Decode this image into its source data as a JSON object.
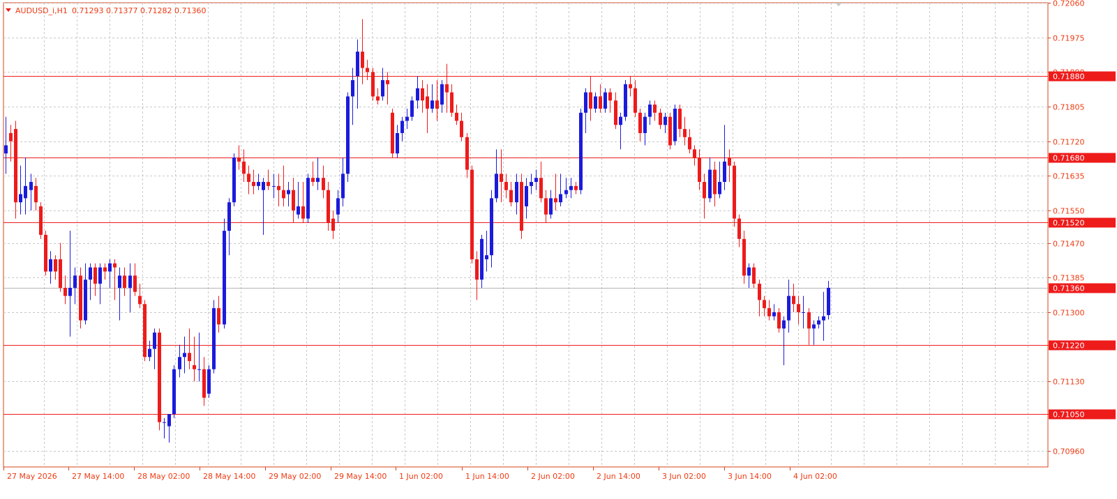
{
  "header": {
    "symbol": "AUDUSD_i,H1",
    "ohlc": "0.71293 0.71377 0.71282 0.71360"
  },
  "colors": {
    "frame": "#d84315",
    "grid": "#c8c8c8",
    "bull": "#1b1bdc",
    "bear": "#ee1b1b",
    "level": "#ee1b1b",
    "price_line": "#b4b4b4",
    "label_bg": "#ee1b1b",
    "label_text": "#ffffff",
    "axis_text": "#ee3a12"
  },
  "chart_data": {
    "type": "candlestick",
    "timeframe": "H1",
    "ylim": [
      0.7092,
      0.7206
    ],
    "y_ticks": [
      "0.72060",
      "0.71975",
      "0.71890",
      "0.71805",
      "0.71720",
      "0.71635",
      "0.71550",
      "0.71470",
      "0.71385",
      "0.71300",
      "0.71220",
      "0.71130",
      "0.71050",
      "0.70960"
    ],
    "x_ticks": [
      "27 May 2026",
      "27 May 14:00",
      "28 May 02:00",
      "28 May 14:00",
      "29 May 02:00",
      "29 May 14:00",
      "1 Jun 02:00",
      "1 Jun 14:00",
      "2 Jun 02:00",
      "2 Jun 14:00",
      "3 Jun 02:00",
      "3 Jun 14:00",
      "4 Jun 02:00"
    ],
    "levels": [
      "0.71880",
      "0.71680",
      "0.71520",
      "0.71220",
      "0.71050"
    ],
    "current_price": "0.71360",
    "candles": [
      {
        "o": 0.7169,
        "h": 0.7178,
        "l": 0.7164,
        "c": 0.7171
      },
      {
        "o": 0.7174,
        "h": 0.7176,
        "l": 0.7167,
        "c": 0.7172
      },
      {
        "o": 0.7175,
        "h": 0.7177,
        "l": 0.7153,
        "c": 0.7157
      },
      {
        "o": 0.7157,
        "h": 0.7166,
        "l": 0.7154,
        "c": 0.7159
      },
      {
        "o": 0.7158,
        "h": 0.7168,
        "l": 0.7154,
        "c": 0.7161
      },
      {
        "o": 0.716,
        "h": 0.7164,
        "l": 0.7155,
        "c": 0.7162
      },
      {
        "o": 0.7161,
        "h": 0.7163,
        "l": 0.7155,
        "c": 0.7157
      },
      {
        "o": 0.7156,
        "h": 0.7157,
        "l": 0.7148,
        "c": 0.7149
      },
      {
        "o": 0.7149,
        "h": 0.715,
        "l": 0.7139,
        "c": 0.714
      },
      {
        "o": 0.714,
        "h": 0.7145,
        "l": 0.7137,
        "c": 0.7143
      },
      {
        "o": 0.7143,
        "h": 0.7144,
        "l": 0.7138,
        "c": 0.714
      },
      {
        "o": 0.7143,
        "h": 0.7147,
        "l": 0.7135,
        "c": 0.7136
      },
      {
        "o": 0.7136,
        "h": 0.7139,
        "l": 0.7132,
        "c": 0.7134
      },
      {
        "o": 0.7134,
        "h": 0.715,
        "l": 0.7124,
        "c": 0.7136
      },
      {
        "o": 0.7136,
        "h": 0.7141,
        "l": 0.7132,
        "c": 0.7139
      },
      {
        "o": 0.7139,
        "h": 0.7141,
        "l": 0.7126,
        "c": 0.7128
      },
      {
        "o": 0.7128,
        "h": 0.7142,
        "l": 0.7127,
        "c": 0.7138
      },
      {
        "o": 0.7138,
        "h": 0.7142,
        "l": 0.7133,
        "c": 0.7141
      },
      {
        "o": 0.7141,
        "h": 0.7142,
        "l": 0.7134,
        "c": 0.7137
      },
      {
        "o": 0.7137,
        "h": 0.7142,
        "l": 0.7132,
        "c": 0.7141
      },
      {
        "o": 0.7141,
        "h": 0.7142,
        "l": 0.7138,
        "c": 0.714
      },
      {
        "o": 0.714,
        "h": 0.7143,
        "l": 0.7136,
        "c": 0.7142
      },
      {
        "o": 0.7142,
        "h": 0.7143,
        "l": 0.7133,
        "c": 0.7141
      },
      {
        "o": 0.7136,
        "h": 0.7141,
        "l": 0.7128,
        "c": 0.7139
      },
      {
        "o": 0.7139,
        "h": 0.7141,
        "l": 0.7134,
        "c": 0.7136
      },
      {
        "o": 0.7136,
        "h": 0.7142,
        "l": 0.713,
        "c": 0.7139
      },
      {
        "o": 0.7139,
        "h": 0.7142,
        "l": 0.7134,
        "c": 0.7135
      },
      {
        "o": 0.7134,
        "h": 0.7137,
        "l": 0.7131,
        "c": 0.7132
      },
      {
        "o": 0.7132,
        "h": 0.7133,
        "l": 0.7118,
        "c": 0.7119
      },
      {
        "o": 0.7119,
        "h": 0.7123,
        "l": 0.7118,
        "c": 0.7121
      },
      {
        "o": 0.7121,
        "h": 0.7126,
        "l": 0.7116,
        "c": 0.7125
      },
      {
        "o": 0.7125,
        "h": 0.7126,
        "l": 0.7101,
        "c": 0.7103
      },
      {
        "o": 0.7103,
        "h": 0.7104,
        "l": 0.7099,
        "c": 0.7103
      },
      {
        "o": 0.7102,
        "h": 0.7105,
        "l": 0.7098,
        "c": 0.7105
      },
      {
        "o": 0.7105,
        "h": 0.7117,
        "l": 0.7104,
        "c": 0.7116
      },
      {
        "o": 0.7116,
        "h": 0.7122,
        "l": 0.7114,
        "c": 0.7119
      },
      {
        "o": 0.7119,
        "h": 0.7124,
        "l": 0.7115,
        "c": 0.712
      },
      {
        "o": 0.712,
        "h": 0.7126,
        "l": 0.7116,
        "c": 0.7118
      },
      {
        "o": 0.7117,
        "h": 0.7124,
        "l": 0.7113,
        "c": 0.7116
      },
      {
        "o": 0.7116,
        "h": 0.7125,
        "l": 0.7113,
        "c": 0.7116
      },
      {
        "o": 0.7116,
        "h": 0.7119,
        "l": 0.7107,
        "c": 0.7109
      },
      {
        "o": 0.711,
        "h": 0.7117,
        "l": 0.7109,
        "c": 0.7116
      },
      {
        "o": 0.7116,
        "h": 0.7133,
        "l": 0.7115,
        "c": 0.7131
      },
      {
        "o": 0.7131,
        "h": 0.7134,
        "l": 0.7125,
        "c": 0.7127
      },
      {
        "o": 0.7127,
        "h": 0.7153,
        "l": 0.7126,
        "c": 0.715
      },
      {
        "o": 0.715,
        "h": 0.7158,
        "l": 0.7144,
        "c": 0.7157
      },
      {
        "o": 0.7157,
        "h": 0.7169,
        "l": 0.7156,
        "c": 0.7168
      },
      {
        "o": 0.7168,
        "h": 0.7171,
        "l": 0.7165,
        "c": 0.7167
      },
      {
        "o": 0.7167,
        "h": 0.717,
        "l": 0.7162,
        "c": 0.7164
      },
      {
        "o": 0.7164,
        "h": 0.7166,
        "l": 0.7159,
        "c": 0.7162
      },
      {
        "o": 0.7162,
        "h": 0.7165,
        "l": 0.7159,
        "c": 0.7161
      },
      {
        "o": 0.7161,
        "h": 0.7164,
        "l": 0.716,
        "c": 0.7162
      },
      {
        "o": 0.716,
        "h": 0.7163,
        "l": 0.7149,
        "c": 0.7162
      },
      {
        "o": 0.7162,
        "h": 0.7165,
        "l": 0.716,
        "c": 0.7161
      },
      {
        "o": 0.7161,
        "h": 0.7164,
        "l": 0.7158,
        "c": 0.7161
      },
      {
        "o": 0.7161,
        "h": 0.7164,
        "l": 0.7156,
        "c": 0.716
      },
      {
        "o": 0.716,
        "h": 0.7166,
        "l": 0.7156,
        "c": 0.7158
      },
      {
        "o": 0.7159,
        "h": 0.7162,
        "l": 0.7156,
        "c": 0.716
      },
      {
        "o": 0.716,
        "h": 0.7163,
        "l": 0.7152,
        "c": 0.7155
      },
      {
        "o": 0.7154,
        "h": 0.7162,
        "l": 0.7153,
        "c": 0.7156
      },
      {
        "o": 0.7156,
        "h": 0.7162,
        "l": 0.7152,
        "c": 0.7153
      },
      {
        "o": 0.7153,
        "h": 0.7164,
        "l": 0.7152,
        "c": 0.7163
      },
      {
        "o": 0.7163,
        "h": 0.7167,
        "l": 0.7161,
        "c": 0.7162
      },
      {
        "o": 0.7162,
        "h": 0.7168,
        "l": 0.716,
        "c": 0.7163
      },
      {
        "o": 0.7163,
        "h": 0.7166,
        "l": 0.7158,
        "c": 0.716
      },
      {
        "o": 0.716,
        "h": 0.7162,
        "l": 0.715,
        "c": 0.7152
      },
      {
        "o": 0.7153,
        "h": 0.7155,
        "l": 0.7148,
        "c": 0.715
      },
      {
        "o": 0.7154,
        "h": 0.716,
        "l": 0.7152,
        "c": 0.7158
      },
      {
        "o": 0.7158,
        "h": 0.7168,
        "l": 0.7156,
        "c": 0.7164
      },
      {
        "o": 0.7164,
        "h": 0.7184,
        "l": 0.7162,
        "c": 0.7183
      },
      {
        "o": 0.7183,
        "h": 0.719,
        "l": 0.7176,
        "c": 0.7187
      },
      {
        "o": 0.7188,
        "h": 0.7197,
        "l": 0.718,
        "c": 0.7194
      },
      {
        "o": 0.7194,
        "h": 0.7202,
        "l": 0.7186,
        "c": 0.719
      },
      {
        "o": 0.719,
        "h": 0.7192,
        "l": 0.7187,
        "c": 0.7189
      },
      {
        "o": 0.7189,
        "h": 0.719,
        "l": 0.7182,
        "c": 0.7183
      },
      {
        "o": 0.7183,
        "h": 0.7185,
        "l": 0.7181,
        "c": 0.7182
      },
      {
        "o": 0.7183,
        "h": 0.719,
        "l": 0.7182,
        "c": 0.7187
      },
      {
        "o": 0.7187,
        "h": 0.7189,
        "l": 0.7181,
        "c": 0.7186
      },
      {
        "o": 0.7179,
        "h": 0.718,
        "l": 0.7168,
        "c": 0.7169
      },
      {
        "o": 0.7169,
        "h": 0.7176,
        "l": 0.7168,
        "c": 0.7174
      },
      {
        "o": 0.7174,
        "h": 0.7178,
        "l": 0.7172,
        "c": 0.7177
      },
      {
        "o": 0.7177,
        "h": 0.718,
        "l": 0.7175,
        "c": 0.7178
      },
      {
        "o": 0.7178,
        "h": 0.7183,
        "l": 0.7177,
        "c": 0.7182
      },
      {
        "o": 0.7182,
        "h": 0.7188,
        "l": 0.718,
        "c": 0.7185
      },
      {
        "o": 0.7185,
        "h": 0.7187,
        "l": 0.7179,
        "c": 0.7182
      },
      {
        "o": 0.7183,
        "h": 0.7186,
        "l": 0.7174,
        "c": 0.718
      },
      {
        "o": 0.718,
        "h": 0.7186,
        "l": 0.7179,
        "c": 0.7182
      },
      {
        "o": 0.7182,
        "h": 0.7187,
        "l": 0.7177,
        "c": 0.718
      },
      {
        "o": 0.7181,
        "h": 0.7187,
        "l": 0.7179,
        "c": 0.7186
      },
      {
        "o": 0.7186,
        "h": 0.7191,
        "l": 0.7179,
        "c": 0.7184
      },
      {
        "o": 0.7184,
        "h": 0.7186,
        "l": 0.7178,
        "c": 0.7179
      },
      {
        "o": 0.7179,
        "h": 0.7181,
        "l": 0.7176,
        "c": 0.7177
      },
      {
        "o": 0.7177,
        "h": 0.7179,
        "l": 0.7172,
        "c": 0.7173
      },
      {
        "o": 0.7173,
        "h": 0.7174,
        "l": 0.7163,
        "c": 0.7165
      },
      {
        "o": 0.7165,
        "h": 0.7166,
        "l": 0.7142,
        "c": 0.7143
      },
      {
        "o": 0.7143,
        "h": 0.7145,
        "l": 0.7133,
        "c": 0.7138
      },
      {
        "o": 0.7138,
        "h": 0.7149,
        "l": 0.7136,
        "c": 0.7148
      },
      {
        "o": 0.7143,
        "h": 0.715,
        "l": 0.714,
        "c": 0.7144
      },
      {
        "o": 0.7144,
        "h": 0.716,
        "l": 0.7141,
        "c": 0.7158
      },
      {
        "o": 0.7158,
        "h": 0.717,
        "l": 0.7157,
        "c": 0.7164
      },
      {
        "o": 0.7164,
        "h": 0.717,
        "l": 0.7157,
        "c": 0.7162
      },
      {
        "o": 0.7162,
        "h": 0.7164,
        "l": 0.7158,
        "c": 0.716
      },
      {
        "o": 0.716,
        "h": 0.7162,
        "l": 0.7156,
        "c": 0.7157
      },
      {
        "o": 0.7157,
        "h": 0.7164,
        "l": 0.7154,
        "c": 0.7162
      },
      {
        "o": 0.7162,
        "h": 0.7164,
        "l": 0.7148,
        "c": 0.715
      },
      {
        "o": 0.7156,
        "h": 0.7163,
        "l": 0.7153,
        "c": 0.7161
      },
      {
        "o": 0.7161,
        "h": 0.7164,
        "l": 0.7159,
        "c": 0.7162
      },
      {
        "o": 0.7162,
        "h": 0.7165,
        "l": 0.716,
        "c": 0.7163
      },
      {
        "o": 0.7163,
        "h": 0.7167,
        "l": 0.7157,
        "c": 0.7158
      },
      {
        "o": 0.7158,
        "h": 0.716,
        "l": 0.7152,
        "c": 0.7154
      },
      {
        "o": 0.7154,
        "h": 0.716,
        "l": 0.7153,
        "c": 0.7158
      },
      {
        "o": 0.7158,
        "h": 0.7164,
        "l": 0.7155,
        "c": 0.7157
      },
      {
        "o": 0.7157,
        "h": 0.7164,
        "l": 0.7156,
        "c": 0.7159
      },
      {
        "o": 0.7159,
        "h": 0.7163,
        "l": 0.7158,
        "c": 0.716
      },
      {
        "o": 0.716,
        "h": 0.7163,
        "l": 0.7158,
        "c": 0.7161
      },
      {
        "o": 0.7161,
        "h": 0.7162,
        "l": 0.7159,
        "c": 0.716
      },
      {
        "o": 0.716,
        "h": 0.718,
        "l": 0.7159,
        "c": 0.7179
      },
      {
        "o": 0.7179,
        "h": 0.7185,
        "l": 0.7174,
        "c": 0.7184
      },
      {
        "o": 0.7184,
        "h": 0.7188,
        "l": 0.7177,
        "c": 0.718
      },
      {
        "o": 0.718,
        "h": 0.7184,
        "l": 0.7179,
        "c": 0.7183
      },
      {
        "o": 0.7183,
        "h": 0.7186,
        "l": 0.7179,
        "c": 0.718
      },
      {
        "o": 0.718,
        "h": 0.7185,
        "l": 0.7179,
        "c": 0.7184
      },
      {
        "o": 0.7184,
        "h": 0.7185,
        "l": 0.7179,
        "c": 0.7182
      },
      {
        "o": 0.7182,
        "h": 0.7184,
        "l": 0.7175,
        "c": 0.7176
      },
      {
        "o": 0.7176,
        "h": 0.7179,
        "l": 0.717,
        "c": 0.7178
      },
      {
        "o": 0.7178,
        "h": 0.7187,
        "l": 0.7177,
        "c": 0.7186
      },
      {
        "o": 0.7186,
        "h": 0.7188,
        "l": 0.7183,
        "c": 0.7185
      },
      {
        "o": 0.7185,
        "h": 0.7187,
        "l": 0.7178,
        "c": 0.7179
      },
      {
        "o": 0.7179,
        "h": 0.718,
        "l": 0.7172,
        "c": 0.7174
      },
      {
        "o": 0.7174,
        "h": 0.7179,
        "l": 0.7171,
        "c": 0.7178
      },
      {
        "o": 0.7178,
        "h": 0.7182,
        "l": 0.7176,
        "c": 0.7181
      },
      {
        "o": 0.7181,
        "h": 0.7182,
        "l": 0.7177,
        "c": 0.7179
      },
      {
        "o": 0.7179,
        "h": 0.718,
        "l": 0.7175,
        "c": 0.7176
      },
      {
        "o": 0.7176,
        "h": 0.7179,
        "l": 0.7174,
        "c": 0.7178
      },
      {
        "o": 0.7178,
        "h": 0.7179,
        "l": 0.717,
        "c": 0.7171
      },
      {
        "o": 0.7172,
        "h": 0.7181,
        "l": 0.7171,
        "c": 0.718
      },
      {
        "o": 0.718,
        "h": 0.7181,
        "l": 0.7173,
        "c": 0.7175
      },
      {
        "o": 0.7175,
        "h": 0.7178,
        "l": 0.7171,
        "c": 0.7173
      },
      {
        "o": 0.7173,
        "h": 0.7175,
        "l": 0.7169,
        "c": 0.717
      },
      {
        "o": 0.717,
        "h": 0.7171,
        "l": 0.7166,
        "c": 0.7168
      },
      {
        "o": 0.7168,
        "h": 0.717,
        "l": 0.716,
        "c": 0.7162
      },
      {
        "o": 0.7162,
        "h": 0.7164,
        "l": 0.7153,
        "c": 0.7158
      },
      {
        "o": 0.7158,
        "h": 0.7168,
        "l": 0.7157,
        "c": 0.7165
      },
      {
        "o": 0.7165,
        "h": 0.7167,
        "l": 0.7156,
        "c": 0.7159
      },
      {
        "o": 0.7159,
        "h": 0.7167,
        "l": 0.7158,
        "c": 0.7162
      },
      {
        "o": 0.7162,
        "h": 0.7176,
        "l": 0.716,
        "c": 0.7167
      },
      {
        "o": 0.7168,
        "h": 0.717,
        "l": 0.7162,
        "c": 0.7166
      },
      {
        "o": 0.7166,
        "h": 0.7167,
        "l": 0.7151,
        "c": 0.7153
      },
      {
        "o": 0.7153,
        "h": 0.7154,
        "l": 0.7146,
        "c": 0.7148
      },
      {
        "o": 0.7148,
        "h": 0.715,
        "l": 0.7137,
        "c": 0.7139
      },
      {
        "o": 0.7139,
        "h": 0.7142,
        "l": 0.7136,
        "c": 0.7141
      },
      {
        "o": 0.7141,
        "h": 0.7142,
        "l": 0.7136,
        "c": 0.7137
      },
      {
        "o": 0.7137,
        "h": 0.7138,
        "l": 0.7129,
        "c": 0.7133
      },
      {
        "o": 0.7133,
        "h": 0.7134,
        "l": 0.7129,
        "c": 0.7131
      },
      {
        "o": 0.7131,
        "h": 0.7133,
        "l": 0.7128,
        "c": 0.7129
      },
      {
        "o": 0.7129,
        "h": 0.7132,
        "l": 0.7128,
        "c": 0.713
      },
      {
        "o": 0.713,
        "h": 0.7131,
        "l": 0.7125,
        "c": 0.7126
      },
      {
        "o": 0.7126,
        "h": 0.7129,
        "l": 0.7117,
        "c": 0.7128
      },
      {
        "o": 0.7128,
        "h": 0.7138,
        "l": 0.7125,
        "c": 0.7134
      },
      {
        "o": 0.7134,
        "h": 0.7137,
        "l": 0.713,
        "c": 0.7132
      },
      {
        "o": 0.7132,
        "h": 0.7134,
        "l": 0.7127,
        "c": 0.713
      },
      {
        "o": 0.713,
        "h": 0.7134,
        "l": 0.7126,
        "c": 0.713
      },
      {
        "o": 0.713,
        "h": 0.7131,
        "l": 0.7122,
        "c": 0.7126
      },
      {
        "o": 0.7126,
        "h": 0.7128,
        "l": 0.7122,
        "c": 0.7127
      },
      {
        "o": 0.7127,
        "h": 0.7129,
        "l": 0.7126,
        "c": 0.7128
      },
      {
        "o": 0.7128,
        "h": 0.7135,
        "l": 0.7123,
        "c": 0.7129
      },
      {
        "o": 0.71293,
        "h": 0.71377,
        "l": 0.71282,
        "c": 0.7136
      }
    ]
  }
}
